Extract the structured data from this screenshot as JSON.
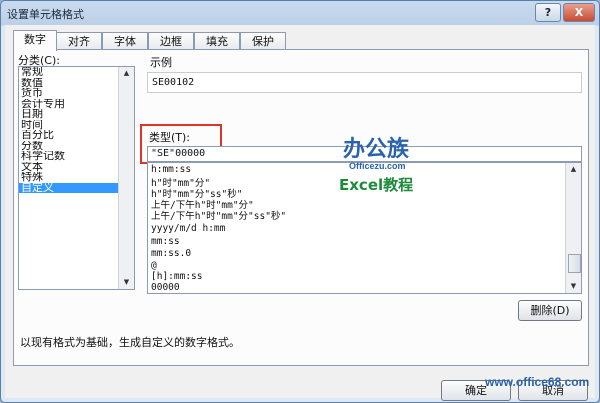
{
  "window": {
    "title": "设置单元格格式",
    "help_label": "?",
    "close_label": "X"
  },
  "tabs": [
    {
      "label": "数字",
      "active": true
    },
    {
      "label": "对齐"
    },
    {
      "label": "字体"
    },
    {
      "label": "边框"
    },
    {
      "label": "填充"
    },
    {
      "label": "保护"
    }
  ],
  "category": {
    "label": "分类(C):",
    "items": [
      "常规",
      "数值",
      "货币",
      "会计专用",
      "日期",
      "时间",
      "百分比",
      "分数",
      "科学记数",
      "文本",
      "特殊",
      "自定义"
    ],
    "selected": "自定义"
  },
  "sample": {
    "label": "示例",
    "value": "SE00102"
  },
  "type": {
    "label": "类型(T):",
    "value": "\"SE\"00000"
  },
  "formats": [
    "h:mm:ss",
    "h\"时\"mm\"分\"",
    "h\"时\"mm\"分\"ss\"秒\"",
    "上午/下午h\"时\"mm\"分\"",
    "上午/下午h\"时\"mm\"分\"ss\"秒\"",
    "yyyy/m/d h:mm",
    "mm:ss",
    "mm:ss.0",
    "@",
    "[h]:mm:ss",
    "00000"
  ],
  "delete_button": "删除(D)",
  "description": "以现有格式为基础，生成自定义的数字格式。",
  "ok_button": "确定",
  "cancel_button": "取消",
  "logo": {
    "title": "办公族",
    "site": "Officezu.com",
    "subtitle": "Excel教程"
  },
  "watermark": "www.office68.com",
  "colors": {
    "accent": "#3399ff",
    "highlight_box": "#e0342a",
    "logo_blue": "#2a63ad",
    "logo_green": "#1e8a3c"
  }
}
